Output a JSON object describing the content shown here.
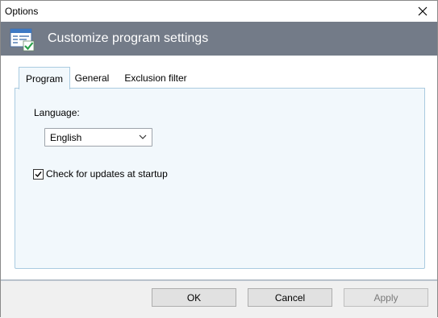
{
  "window": {
    "title": "Options"
  },
  "banner": {
    "title": "Customize program settings",
    "icon": "settings-window-icon"
  },
  "tabs": [
    {
      "label": "Program",
      "active": true
    },
    {
      "label": "General",
      "active": false
    },
    {
      "label": "Exclusion filter",
      "active": false
    }
  ],
  "program_tab": {
    "language_label": "Language:",
    "language_value": "English",
    "check_updates_label": "Check for updates at startup",
    "check_updates_checked": true
  },
  "buttons": {
    "ok": "OK",
    "cancel": "Cancel",
    "apply": "Apply",
    "apply_enabled": false
  },
  "colors": {
    "banner_bg": "#737b88",
    "panel_bg": "#f2f8fc",
    "panel_border": "#aacbe0"
  }
}
